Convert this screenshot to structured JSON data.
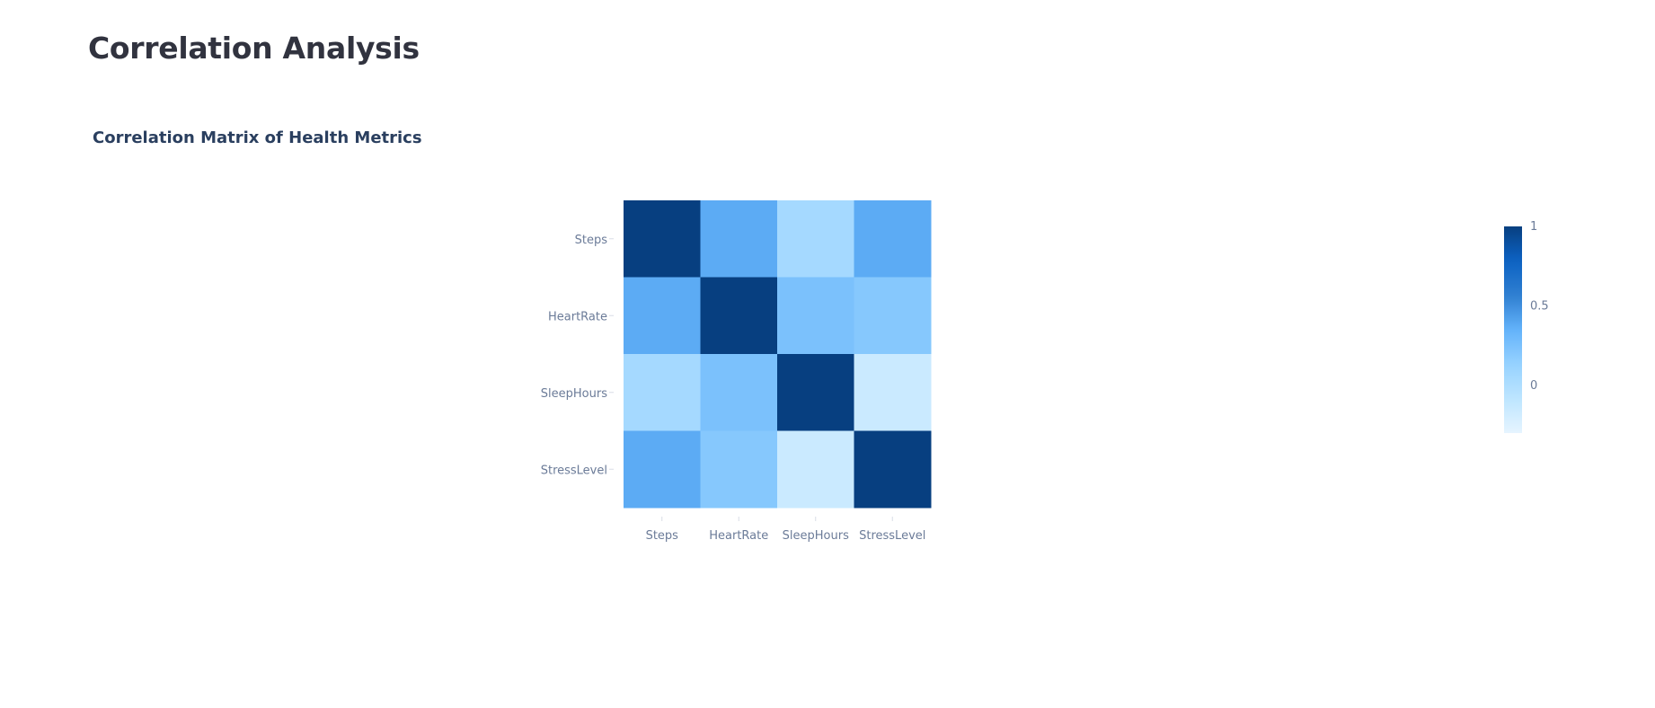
{
  "page": {
    "title": "Correlation Analysis"
  },
  "chart_data": {
    "type": "heatmap",
    "title": "Correlation Matrix of Health Metrics",
    "x": [
      "Steps",
      "HeartRate",
      "SleepHours",
      "StressLevel"
    ],
    "y": [
      "Steps",
      "HeartRate",
      "SleepHours",
      "StressLevel"
    ],
    "z": [
      [
        1.0,
        0.38,
        0.05,
        0.38
      ],
      [
        0.38,
        1.0,
        0.25,
        0.2
      ],
      [
        0.05,
        0.25,
        1.0,
        -0.15
      ],
      [
        0.38,
        0.2,
        -0.15,
        1.0
      ]
    ],
    "colorbar": {
      "tick_labels": [
        "1",
        "0.5",
        "0"
      ],
      "tick_values": [
        1,
        0.5,
        0
      ],
      "range": [
        -0.3,
        1.0
      ]
    },
    "colorscale": [
      "#e6f4ff",
      "#bde5ff",
      "#96d2ff",
      "#63b2fa",
      "#2f7fd0",
      "#0c62c4",
      "#073f80"
    ],
    "xlabel": "",
    "ylabel": "",
    "grid": false,
    "legend": "right"
  }
}
